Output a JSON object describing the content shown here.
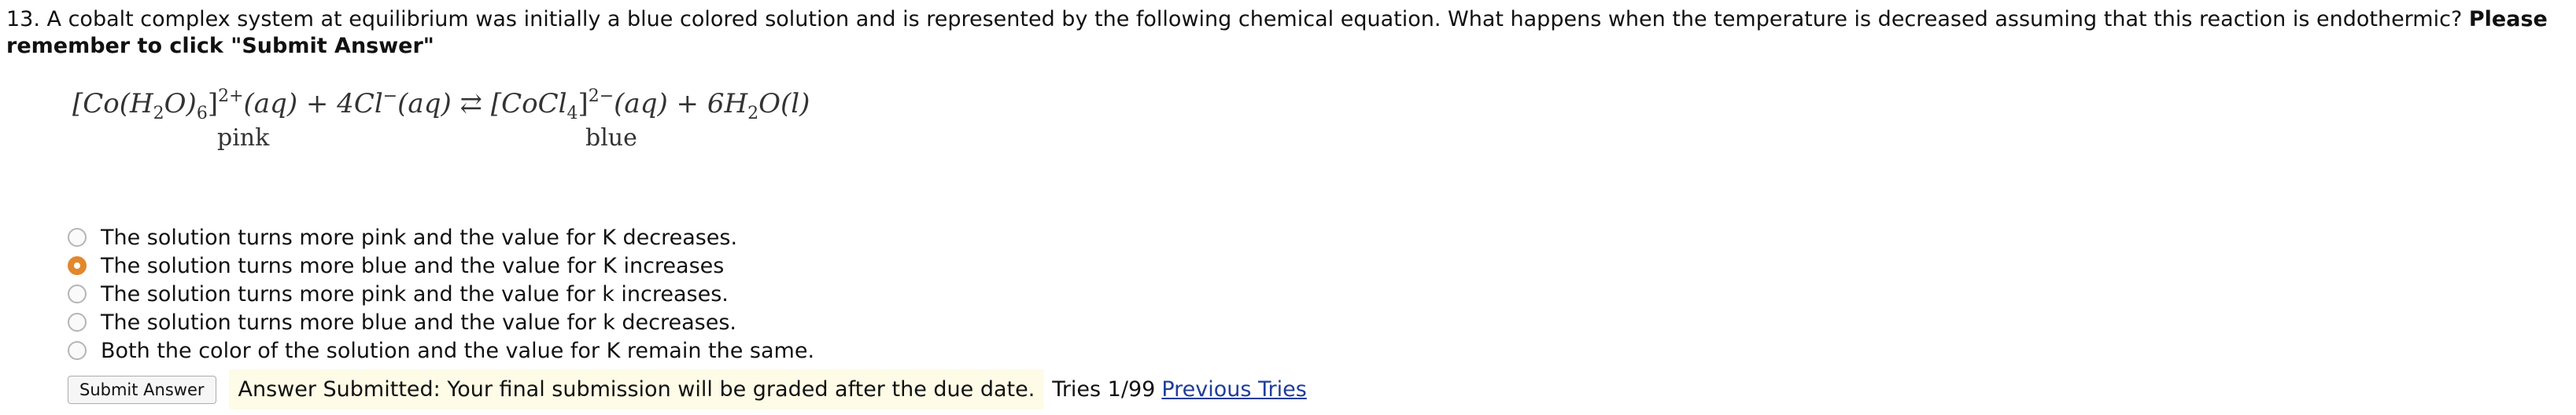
{
  "question": {
    "text": "13. A cobalt complex system at equilibrium was initially a blue colored solution and is represented by the following chemical equation. What happens when the temperature is decreased assuming that this reaction is endothermic? ",
    "instruction": "Please remember to click \"Submit Answer\""
  },
  "equation": {
    "lhs_open": "[Co(H",
    "sub2": "2",
    "lhs_mid": "O)",
    "sub6": "6",
    "lhs_close": "]",
    "charge_plus": "2+",
    "aq1": "(aq) + 4Cl",
    "minus": "−",
    "aq2": "(aq) ⇄ [CoCl",
    "sub4": "4",
    "rhs_close": "]",
    "charge_minus": "2−",
    "aq3": "(aq) + 6H",
    "sub2b": "2",
    "water": "O(l)",
    "label_pink": "pink",
    "label_blue": "blue"
  },
  "options": [
    {
      "label": "The solution turns more pink and the value for K decreases.",
      "selected": false
    },
    {
      "label": "The solution turns more blue and the value for K increases",
      "selected": true
    },
    {
      "label": "The solution turns more pink and the value for k increases.",
      "selected": false
    },
    {
      "label": "The solution turns more blue and the value for k decreases.",
      "selected": false
    },
    {
      "label": "Both the color of the solution and the value for K remain the same.",
      "selected": false
    }
  ],
  "footer": {
    "submit_label": "Submit Answer",
    "status": "Answer Submitted: Your final submission will be graded after the due date.",
    "tries": "Tries 1/99",
    "previous_tries": "Previous Tries"
  },
  "colors": {
    "selected_radio": "#e2882c",
    "status_background": "#fefbe7",
    "link": "#1f3d99"
  }
}
